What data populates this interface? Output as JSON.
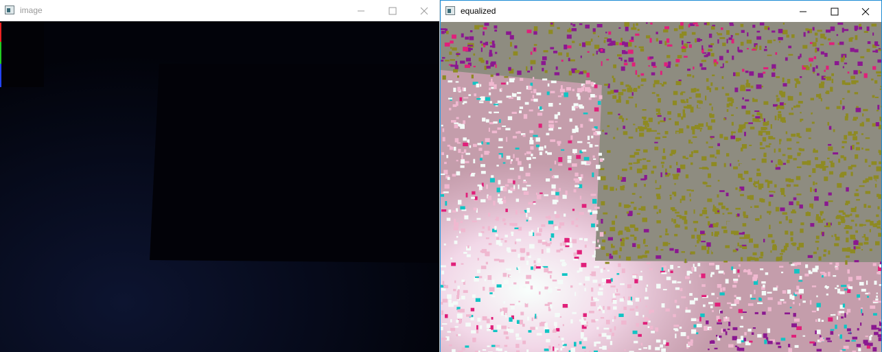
{
  "windows": {
    "image": {
      "title": "image",
      "title_color": "#999999"
    },
    "equalized": {
      "title": "equalized",
      "title_color": "#000000",
      "border_color": "#1a8ad4"
    }
  },
  "controls": [
    "minimize-icon",
    "maximize-icon",
    "close-icon"
  ],
  "colors": {
    "image_bg": "#010208",
    "image_glow": "#0b1025",
    "eq_gray": "#8e8c80",
    "eq_olive": "#8e8a22",
    "eq_purple": "#8a1890",
    "eq_magenta": "#e0207a",
    "eq_cyan": "#10c4c4",
    "eq_pink": "#f0b8d0",
    "eq_white": "#f4fbf8"
  }
}
